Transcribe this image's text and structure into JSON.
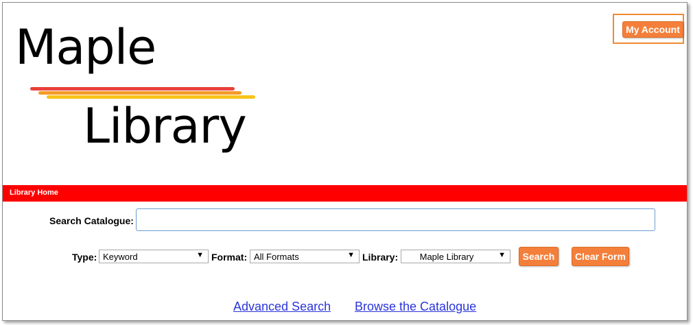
{
  "logo": {
    "line1": "Maple",
    "line2": "Library",
    "stroke_colors": [
      "#e8413a",
      "#f59a2a",
      "#f7c41a"
    ]
  },
  "header": {
    "account_button": "My Account"
  },
  "nav": {
    "home_label": "Library Home",
    "bar_color": "#ff0000"
  },
  "search": {
    "label": "Search Catalogue:",
    "value": ""
  },
  "filters": {
    "type_label": "Type:",
    "type_value": "Keyword",
    "format_label": "Format:",
    "format_value": "All Formats",
    "library_label": "Library:",
    "library_value": "Maple Library",
    "dropdown_arrow": "▼"
  },
  "buttons": {
    "search": "Search",
    "clear": "Clear Form",
    "accent": "#f47f3a"
  },
  "links": {
    "advanced": "Advanced Search",
    "browse": "Browse the Catalogue"
  }
}
